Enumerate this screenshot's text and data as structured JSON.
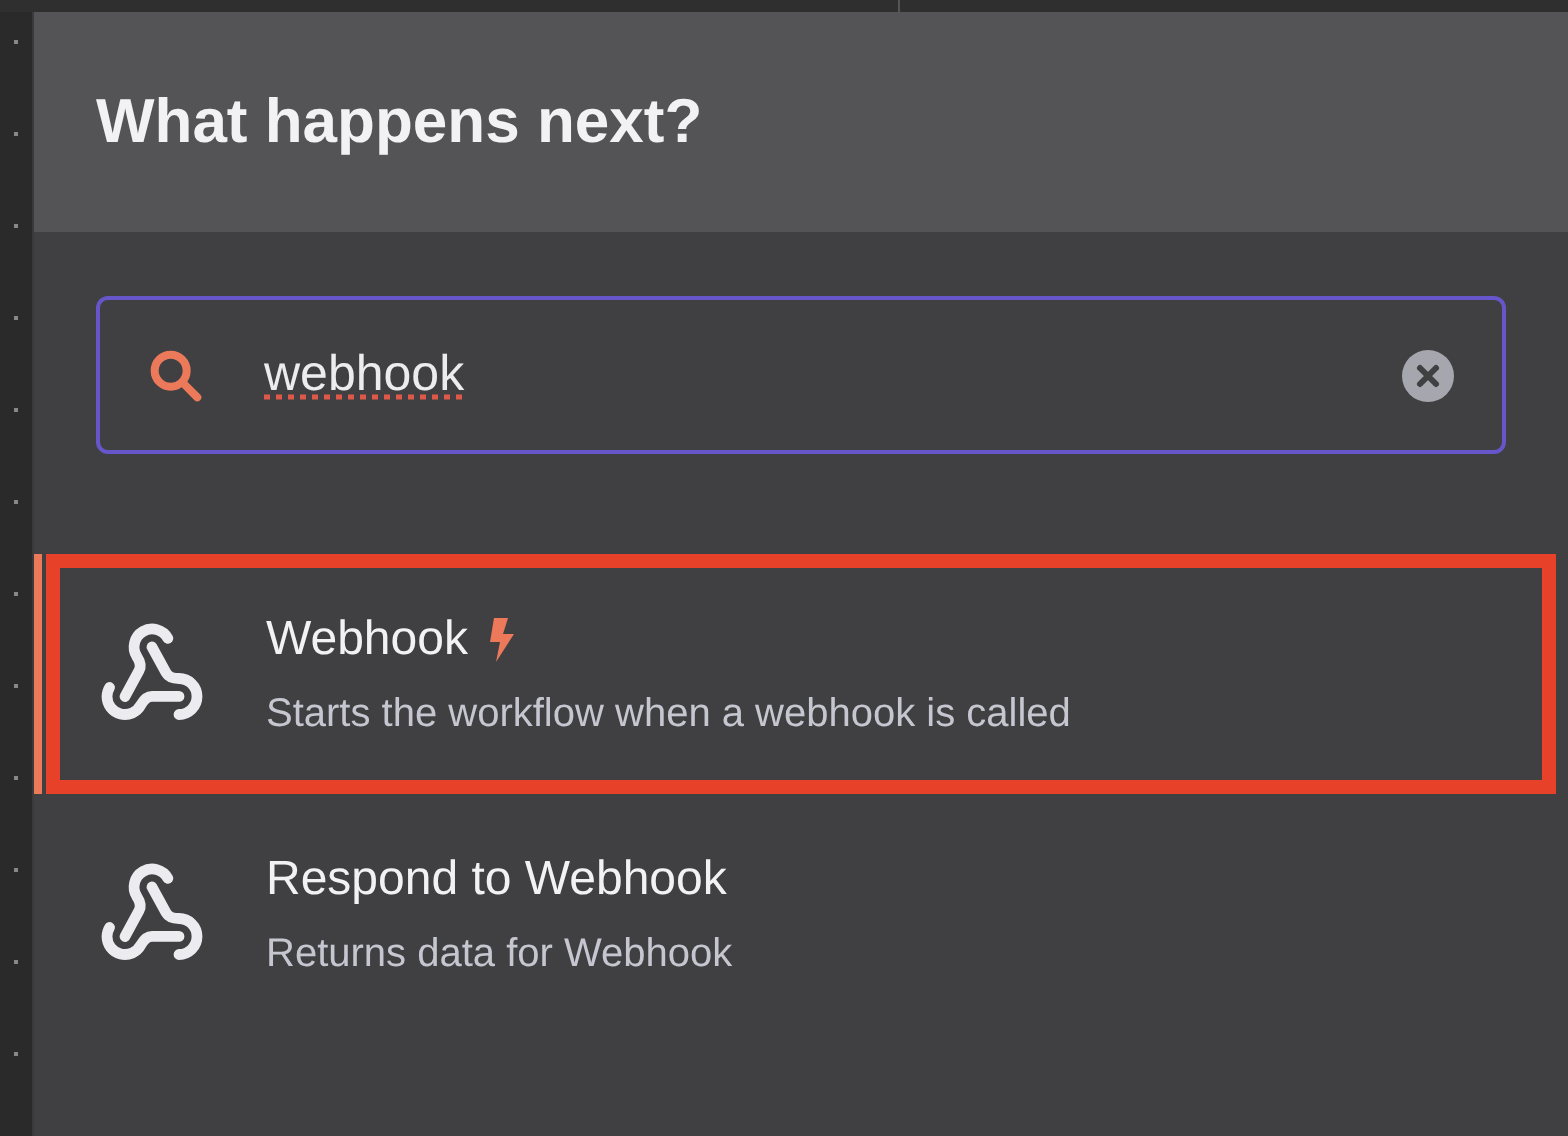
{
  "panel": {
    "title": "What happens next?"
  },
  "search": {
    "value": "webhook"
  },
  "nodes": [
    {
      "name": "Webhook",
      "description": "Starts the workflow when a webhook is called",
      "trigger": true,
      "selected": true,
      "highlighted": true
    },
    {
      "name": "Respond to Webhook",
      "description": "Returns data for Webhook",
      "trigger": false,
      "selected": false,
      "highlighted": false
    }
  ]
}
